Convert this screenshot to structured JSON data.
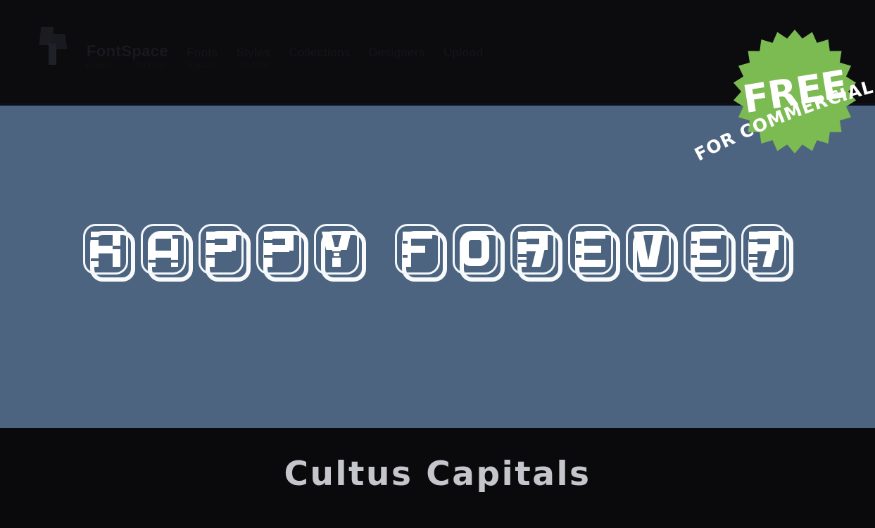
{
  "page": {
    "background_dark": "#0a0a0c",
    "background_stage": "#4c6480",
    "accent_green": "#7cba52"
  },
  "topbar": {
    "logo_name": "site-logo",
    "brand": "FontSpace",
    "nav": [
      {
        "label": "Fonts"
      },
      {
        "label": "Styles"
      },
      {
        "label": "Collections"
      },
      {
        "label": "Designers"
      },
      {
        "label": "Upload"
      }
    ],
    "sub": [
      {
        "label": "Home"
      },
      {
        "label": "Techno"
      },
      {
        "label": "Square"
      },
      {
        "label": "Outline"
      }
    ]
  },
  "badge": {
    "primary": "FREE",
    "secondary": "FOR COMMERCIAL USE",
    "color": "#7cba52"
  },
  "preview": {
    "sample_text": "HAPPY FOREVER",
    "tiles": [
      {
        "letter": "H"
      },
      {
        "letter": "A"
      },
      {
        "letter": "P"
      },
      {
        "letter": "P"
      },
      {
        "letter": "Y"
      },
      {
        "letter": " "
      },
      {
        "letter": "F"
      },
      {
        "letter": "O"
      },
      {
        "letter": "R"
      },
      {
        "letter": "E"
      },
      {
        "letter": "V"
      },
      {
        "letter": "E"
      },
      {
        "letter": "R"
      }
    ]
  },
  "footer": {
    "font_name": "Cultus Capitals"
  }
}
